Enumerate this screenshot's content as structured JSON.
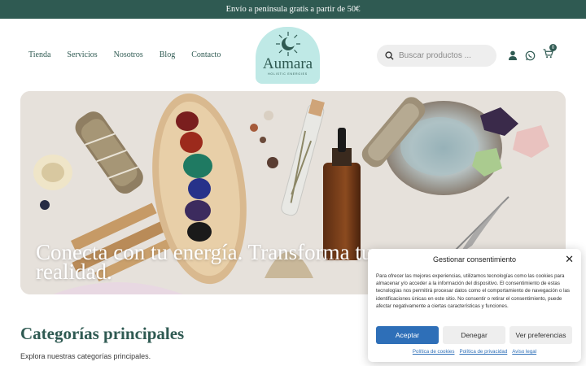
{
  "promo": {
    "text": "Envío a península gratis a partir de 50€"
  },
  "nav": {
    "items": [
      "Tienda",
      "Servicios",
      "Nosotros",
      "Blog",
      "Contacto"
    ]
  },
  "logo": {
    "name": "Aumara",
    "tagline": "HOLISTIC ENERGIES"
  },
  "search": {
    "placeholder": "Buscar productos ..."
  },
  "cart": {
    "count": "0"
  },
  "hero": {
    "title": "Conecta con tu energía. Transforma tu realidad."
  },
  "categories": {
    "title": "Categorías principales",
    "subtitle": "Explora nuestras categorías principales."
  },
  "consent": {
    "title": "Gestionar consentimiento",
    "text": "Para ofrecer las mejores experiencias, utilizamos tecnologías como las cookies para almacenar y/o acceder a la información del dispositivo. El consentimiento de estas tecnologías nos permitirá procesar datos como el comportamiento de navegación o las identificaciones únicas en este sitio. No consentir o retirar el consentimiento, puede afectar negativamente a ciertas características y funciones.",
    "accept": "Aceptar",
    "deny": "Denegar",
    "preferences": "Ver preferencias",
    "links": [
      "Política de cookies",
      "Política de privacidad",
      "Aviso legal"
    ]
  },
  "colors": {
    "brand": "#2f5a52",
    "logo_bg": "#bfe9e6",
    "accent_blue": "#2e6fb8"
  },
  "icons": [
    "search-icon",
    "user-icon",
    "whatsapp-icon",
    "cart-icon",
    "close-icon"
  ]
}
